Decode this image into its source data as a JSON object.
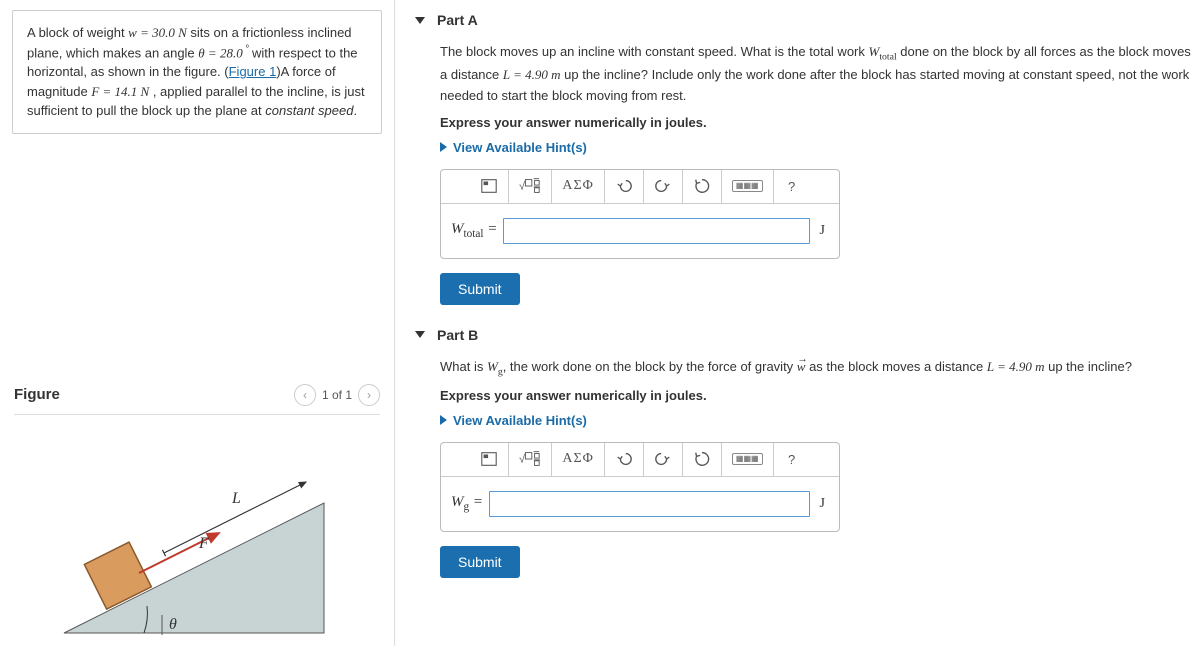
{
  "problem": {
    "intro_p1a": "A block of weight ",
    "w_eq": "w = 30.0 N",
    "intro_p1b": " sits on a frictionless inclined plane, which makes an angle ",
    "theta_eq": "θ = 28.0",
    "deg_text": " ° ",
    "intro_p1c": " with respect to the horizontal, as shown in the figure. (",
    "fig_link": "Figure 1",
    "intro_p1d": ")A force of magnitude ",
    "F_eq": "F = 14.1 N",
    "intro_p1e": " , applied parallel to the incline, is just sufficient to pull the block up the plane at ",
    "constant_speed": "constant speed",
    "period": "."
  },
  "figure": {
    "title": "Figure",
    "counter": "1 of 1",
    "labels": {
      "L": "L",
      "F": "F",
      "theta": "θ"
    }
  },
  "partA": {
    "title": "Part A",
    "q1": "The block moves up an incline with constant speed. What is the total work ",
    "Wtot": "W",
    "Wtot_sub": "total",
    "q2": " done on the block by all forces as the block moves a distance ",
    "L_eq": "L = 4.90 m",
    "q3": " up the incline? Include only the work done after the block has started moving at constant speed, not the work needed to start the block moving from rest.",
    "instruction": "Express your answer numerically in joules.",
    "hints": "View Available Hint(s)",
    "var_label_main": "W",
    "var_label_sub": "total",
    "equals": " = ",
    "unit": "J",
    "submit": "Submit"
  },
  "partB": {
    "title": "Part B",
    "q1": "What is ",
    "Wg": "W",
    "Wg_sub": "g",
    "q2": ", the work done on the block by the force of gravity ",
    "wvec": "w",
    "q3": " as the block moves a distance ",
    "L_eq": "L = 4.90 m",
    "q4": " up the incline?",
    "instruction": "Express your answer numerically in joules.",
    "hints": "View Available Hint(s)",
    "var_label_main": "W",
    "var_label_sub": "g",
    "equals": " = ",
    "unit": "J",
    "submit": "Submit"
  },
  "toolbar": {
    "greek": "ΑΣΦ",
    "help": "?"
  }
}
